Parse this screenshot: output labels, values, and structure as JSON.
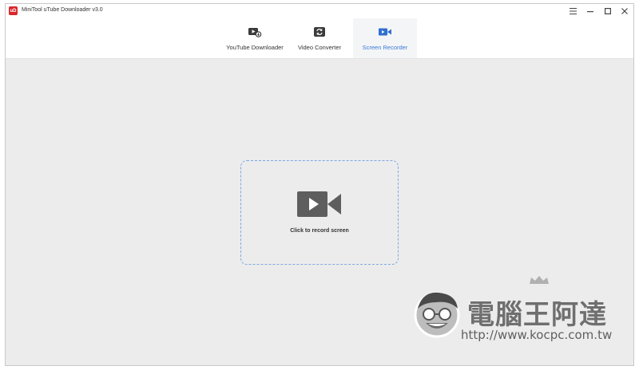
{
  "window": {
    "logo_text": "uD",
    "title": "MiniTool uTube Downloader v3.0"
  },
  "window_controls": {
    "menu_icon": "hamburger-menu-icon",
    "minimize_icon": "minimize-icon",
    "maximize_icon": "maximize-icon",
    "close_icon": "close-icon"
  },
  "tabs": [
    {
      "label": "YouTube Downloader",
      "icon": "video-download-icon",
      "active": false
    },
    {
      "label": "Video Converter",
      "icon": "convert-icon",
      "active": false
    },
    {
      "label": "Screen Recorder",
      "icon": "camcorder-icon",
      "active": true
    }
  ],
  "recorder": {
    "icon": "video-camera-play-icon",
    "label": "Click to record screen"
  },
  "watermark": {
    "title": "電腦王阿達",
    "url": "http://www.kocpc.com.tw"
  },
  "colors": {
    "accent": "#3a7bd5",
    "logo": "#d7282c",
    "content_bg": "#ececec",
    "dashed_border": "#7aa7e6"
  }
}
